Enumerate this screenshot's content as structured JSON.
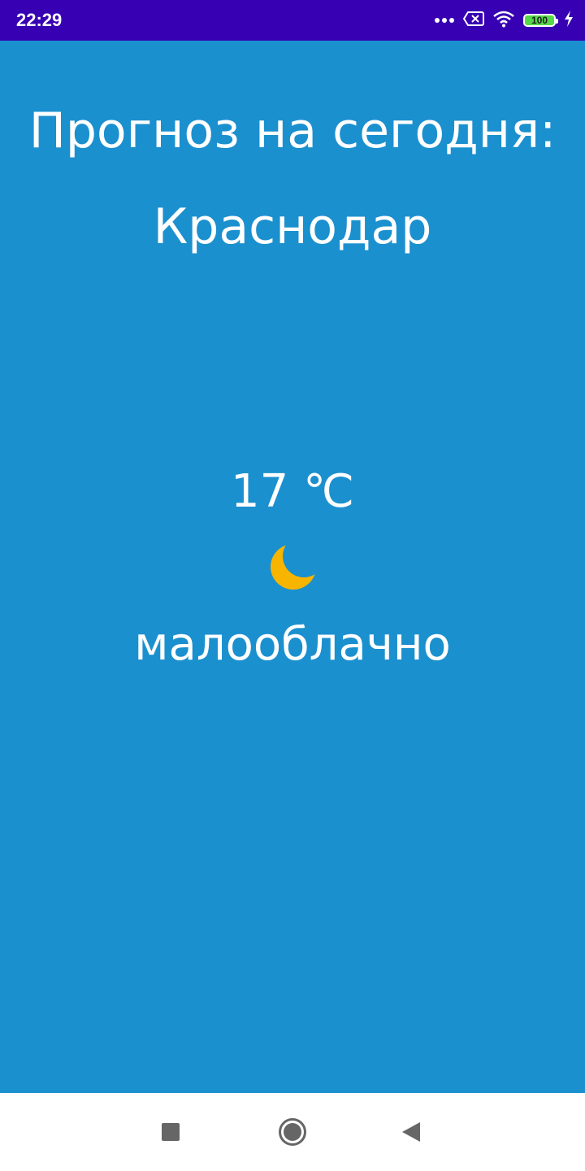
{
  "status_bar": {
    "time": "22:29",
    "battery_level": "100",
    "background_color": "#3700b3",
    "icons": [
      "more-dots-icon",
      "no-sim-icon",
      "wifi-icon",
      "battery-icon",
      "charging-bolt-icon"
    ]
  },
  "forecast": {
    "heading": "Прогноз на сегодня:",
    "city": "Краснодар",
    "temperature": "17 ℃",
    "weather_icon": "crescent-moon-icon",
    "condition": "малооблачно",
    "background_color": "#1b90cf"
  },
  "nav_bar": {
    "icons": [
      "recent-apps-icon",
      "home-icon",
      "back-icon"
    ]
  }
}
